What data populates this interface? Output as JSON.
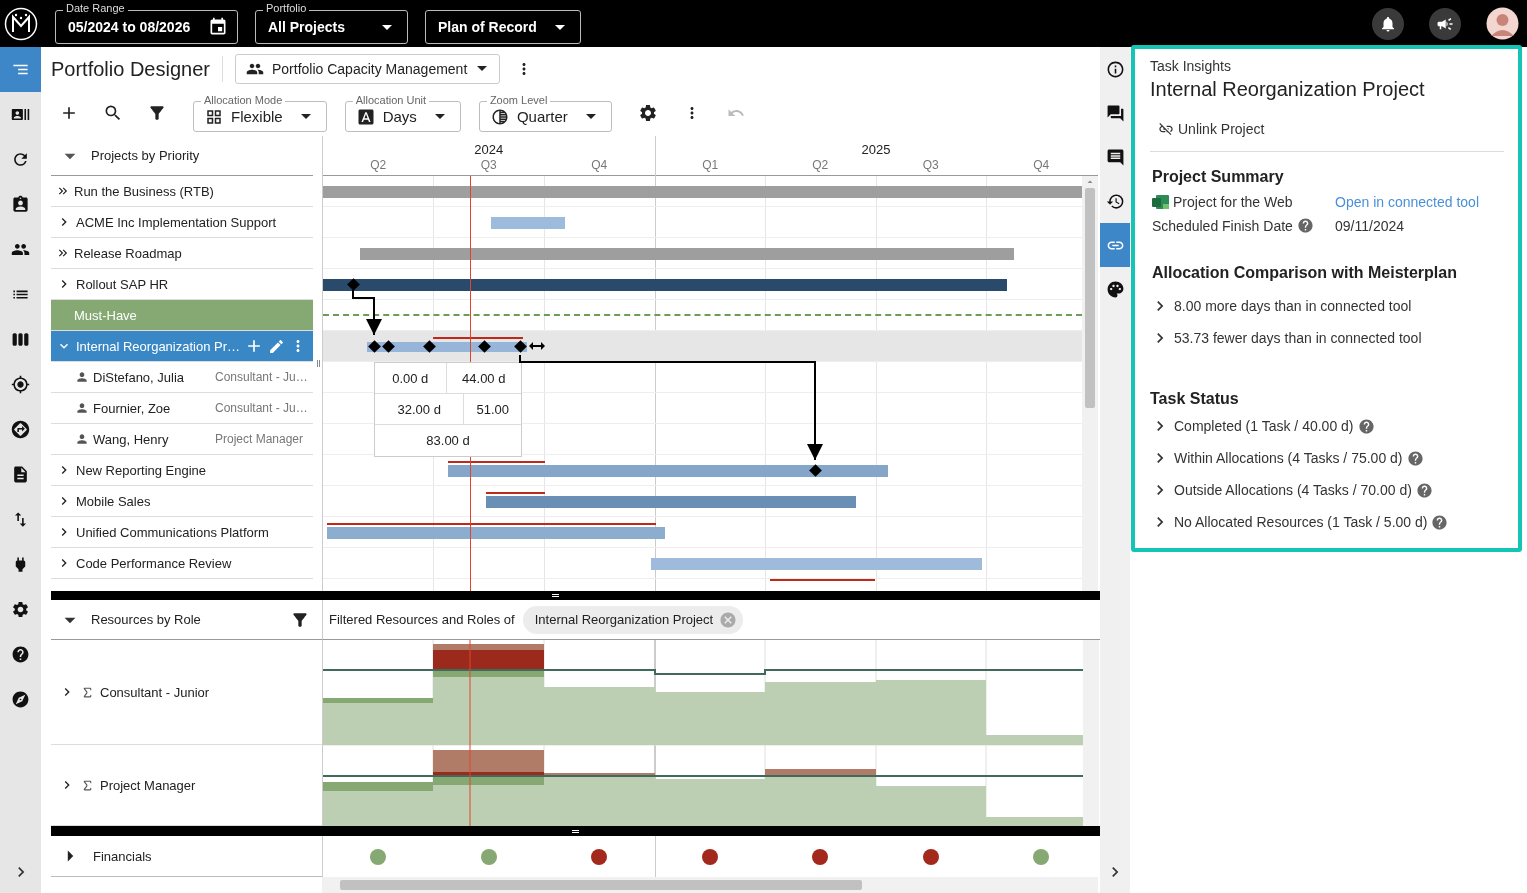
{
  "top_bar": {
    "fields": [
      {
        "kind": "date",
        "label": "Date Range",
        "value": "05/2024 to 08/2026"
      },
      {
        "kind": "select",
        "label": "Portfolio",
        "value": "All Projects"
      },
      {
        "kind": "select",
        "value": "Plan of Record"
      }
    ]
  },
  "nav": [
    {
      "selected": true
    },
    {
      "selected": false
    },
    {
      "selected": false
    },
    {
      "selected": false
    },
    {
      "selected": false
    },
    {
      "selected": false
    },
    {
      "selected": false
    },
    {
      "selected": false
    },
    {
      "selected": false
    },
    {
      "selected": false
    },
    {
      "selected": false
    },
    {
      "selected": false
    },
    {
      "selected": false
    },
    {
      "selected": false
    },
    {
      "selected": false
    }
  ],
  "page": {
    "title": "Portfolio Designer",
    "view": "Portfolio Capacity Management"
  },
  "toolbar": {
    "fields": [
      {
        "kind": "mode",
        "label": "Allocation Mode",
        "value": "Flexible"
      },
      {
        "kind": "unit",
        "label": "Allocation Unit",
        "value": "Days"
      },
      {
        "kind": "zoom",
        "label": "Zoom Level",
        "value": "Quarter"
      }
    ],
    "undo": {
      "disabled": true
    }
  },
  "gantt": {
    "tree_header": "Projects by Priority",
    "years": [
      "2024",
      "2025"
    ],
    "quarters": [
      "Q2",
      "Q3",
      "Q4",
      "Q1",
      "Q2",
      "Q3",
      "Q4"
    ],
    "rows": [
      {
        "kind": "program",
        "label": "Run the Business (RTB)"
      },
      {
        "kind": "project",
        "label": "ACME Inc Implementation Support",
        "expanded": false,
        "selected": false
      },
      {
        "kind": "program",
        "label": "Release Roadmap"
      },
      {
        "kind": "project",
        "label": "Rollout SAP HR",
        "expanded": false,
        "selected": false
      },
      {
        "kind": "priority",
        "label": "Must-Have"
      },
      {
        "kind": "project",
        "label": "Internal Reorganization Pr…",
        "expanded": true,
        "selected": true
      },
      {
        "kind": "resource",
        "label": "DiStefano, Julia",
        "role": "Consultant - Ju…"
      },
      {
        "kind": "resource",
        "label": "Fournier, Zoe",
        "role": "Consultant - Ju…"
      },
      {
        "kind": "resource",
        "label": "Wang, Henry",
        "role": "Project Manager"
      },
      {
        "kind": "project",
        "label": "New Reporting Engine",
        "expanded": false,
        "selected": false
      },
      {
        "kind": "project",
        "label": "Mobile Sales",
        "expanded": false,
        "selected": false
      },
      {
        "kind": "project",
        "label": "Unified Communications Platform",
        "expanded": false,
        "selected": false
      },
      {
        "kind": "project",
        "label": "Code Performance Review",
        "expanded": false,
        "selected": false
      }
    ],
    "allocation_popup": [
      [
        "0.00 d",
        "44.00 d"
      ],
      [
        "32.00 d",
        "51.00"
      ],
      [
        "83.00 d"
      ]
    ]
  },
  "resources": {
    "header": "Resources by Role",
    "filter_label": "Filtered Resources and Roles of",
    "filter_chip": "Internal Reorganization Project",
    "roles": [
      {
        "name": "Consultant - Junior",
        "expanded": false
      },
      {
        "name": "Project Manager",
        "expanded": false
      }
    ]
  },
  "financials": {
    "label": "Financials",
    "expanded": false,
    "dots": [
      {
        "color": "#86a873"
      },
      {
        "color": "#86a873"
      },
      {
        "color": "#a3291c"
      },
      {
        "color": "#a3291c"
      },
      {
        "color": "#a3291c"
      },
      {
        "color": "#a3291c"
      },
      {
        "color": "#86a873"
      }
    ]
  },
  "right_rail": [
    {
      "selected": false
    },
    {
      "selected": false
    },
    {
      "selected": false
    },
    {
      "selected": false
    },
    {
      "selected": true
    },
    {
      "selected": false
    }
  ],
  "insights": {
    "eyebrow": "Task Insights",
    "title": "Internal Reorganization Project",
    "unlink": "Unlink Project",
    "summary": {
      "heading": "Project Summary",
      "tool": "Project for the Web",
      "link": "Open in connected tool",
      "date_label": "Scheduled Finish Date",
      "date": "09/11/2024"
    },
    "comparison": {
      "heading": "Allocation Comparison with Meisterplan",
      "items": [
        {
          "label": "8.00 more days than in connected tool",
          "expanded": false
        },
        {
          "label": "53.73 fewer days than in connected tool",
          "expanded": false
        }
      ]
    },
    "status": {
      "heading": "Task Status",
      "items": [
        {
          "label": "Completed (1 Task / 40.00 d)",
          "expanded": false
        },
        {
          "label": "Within Allocations (4 Tasks / 75.00 d)",
          "expanded": false
        },
        {
          "label": "Outside Allocations (4 Tasks / 70.00 d)",
          "expanded": false
        },
        {
          "label": "No Allocated Resources (1 Task / 5.00 d)",
          "expanded": false
        }
      ]
    }
  }
}
